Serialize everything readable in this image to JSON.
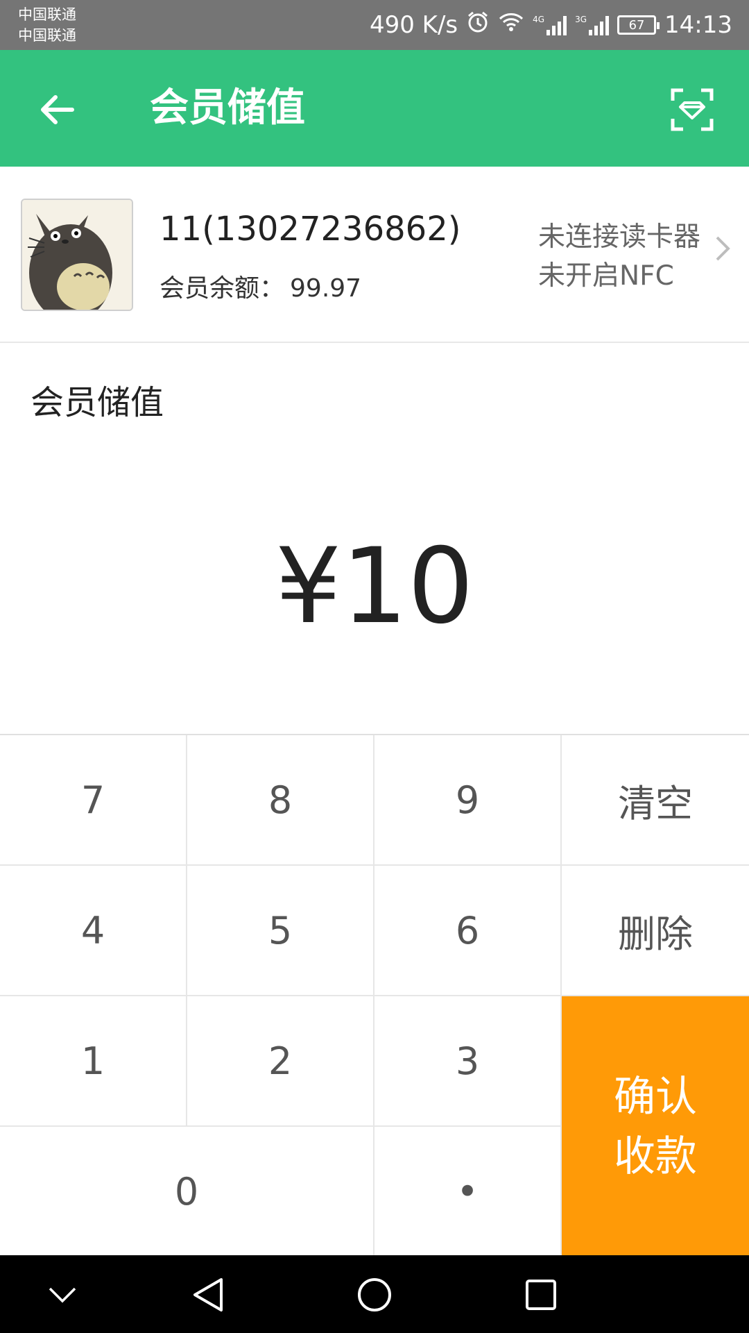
{
  "status_bar": {
    "carrier_1": "中国联通",
    "carrier_2": "中国联通",
    "speed": "490 K/s",
    "net_4g": "4G",
    "net_3g": "3G",
    "battery": "67",
    "time": "14:13",
    "icons": [
      "alarm-icon",
      "wifi-icon",
      "signal-4g-icon",
      "signal-3g-icon",
      "battery-icon"
    ]
  },
  "app_bar": {
    "title": "会员储值",
    "back_icon": "arrow-left-icon",
    "scan_icon": "scan-card-icon"
  },
  "member": {
    "name": "11(13027236862)",
    "balance_label": "会员余额：",
    "balance_value": "99.97",
    "reader_status": "未连接读卡器",
    "nfc_status": "未开启NFC"
  },
  "recharge": {
    "section_label": "会员储值",
    "amount": "¥10"
  },
  "keypad": {
    "k7": "7",
    "k8": "8",
    "k9": "9",
    "clear": "清空",
    "k4": "4",
    "k5": "5",
    "k6": "6",
    "delete": "删除",
    "k1": "1",
    "k2": "2",
    "k3": "3",
    "k0": "0",
    "dot": "•",
    "confirm_line1": "确认",
    "confirm_line2": "收款"
  },
  "colors": {
    "primary": "#33c27f",
    "confirm": "#ff9a07",
    "status_bar": "#757575"
  }
}
